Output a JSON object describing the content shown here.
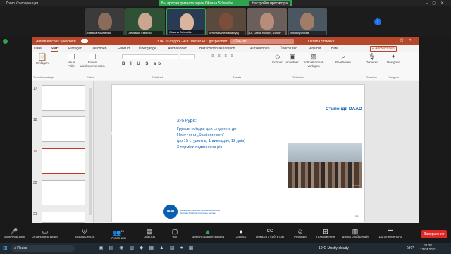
{
  "zoom": {
    "app_title": "Zoom Конференция",
    "share_banner": "Вы просматриваете экран Oksana Schwalke",
    "view_options": "Настройки просмотра",
    "participants": [
      {
        "name": "Nataliia Kovalenko"
      },
      {
        "name": "Oleksandr Lebenko"
      },
      {
        "name": "Oksana Schwalke"
      },
      {
        "name": "Тетяна Валеріївна Кущ"
      },
      {
        "name": "Dr. Olena Kovtun, NUBiP"
      },
      {
        "name": "Nekonnyi Vitalii"
      }
    ],
    "controls": [
      {
        "label": "Включить звук",
        "icon": "🎤"
      },
      {
        "label": "Остановить видео",
        "icon": "▭"
      },
      {
        "label": "Безопасность",
        "icon": "⛨"
      },
      {
        "label": "Участники",
        "icon": "👥",
        "count": "25"
      },
      {
        "label": "Опросы",
        "icon": "▤"
      },
      {
        "label": "Чат",
        "icon": "▢"
      },
      {
        "label": "Демонстрация экрана",
        "icon": "▲"
      },
      {
        "label": "Запись",
        "icon": "●"
      },
      {
        "label": "Показать субтитры",
        "icon": "CC"
      },
      {
        "label": "Реакции",
        "icon": "☺"
      },
      {
        "label": "Приложения",
        "icon": "⊞"
      },
      {
        "label": "Доска сообщений",
        "icon": "▥"
      },
      {
        "label": "Дополнительно",
        "icon": "•••"
      }
    ],
    "end_button": "Завершение"
  },
  "ppt": {
    "autosave": "Automatisches Speichern",
    "file_title": "13.04.2023.pptx - Auf \"Dieser PC\" gespeichert",
    "search_placeholder": "Suchen",
    "user": "Oksana Shwalke",
    "menu": [
      "Datei",
      "Start",
      "Einfügen",
      "Zeichnen",
      "Entwurf",
      "Übergänge",
      "Animationen",
      "Bildschirmpräsentation",
      "Aufzeichnen",
      "Überprüfen",
      "Ansicht",
      "Hilfe"
    ],
    "record_btn": "Aufzeichnen",
    "ribbon": {
      "paste": "Einfügen",
      "new_slide": "Neue Folie",
      "reuse": "Folien wiederverwenden",
      "shapes": "Formen",
      "arrange": "Anordnen",
      "quick_styles": "Schnellformat-vorlagen",
      "edit": "Bearbeiten",
      "dictate": "Diktieren",
      "designer": "Designer",
      "groups": [
        "Zwischenablage",
        "Folien",
        "Schriftart",
        "Absatz",
        "Zeichnen",
        "Sprache",
        "Designer"
      ]
    },
    "thumbnails": [
      "17",
      "18",
      "19",
      "20",
      "21"
    ],
    "slide": {
      "header": "Стипендії DAAD",
      "heading": "2-5 курс:",
      "lines": [
        "Групові поїздки для студентів до",
        "Німеччини „Studienreisen“",
        "(до 15 студентів, 1 викладач, 12 днів)",
        "3 терміни подання на рік"
      ],
      "logo": "DAAD",
      "logo_text1": "Deutscher Akademischer Austauschdienst",
      "logo_text2": "German Academic Exchange Service",
      "page_num": "59",
      "photo_caption": "© private"
    }
  },
  "taskbar": {
    "search": "Поиск",
    "weather": "10°C  Mostly cloudy",
    "lang": "УКР",
    "time": "11:28",
    "date": "13.04.2023"
  },
  "colors": {
    "ppt_accent": "#b7472a",
    "zoom_green": "#2ea44f",
    "daad_blue": "#0b5fb0",
    "end_red": "#e02828"
  }
}
